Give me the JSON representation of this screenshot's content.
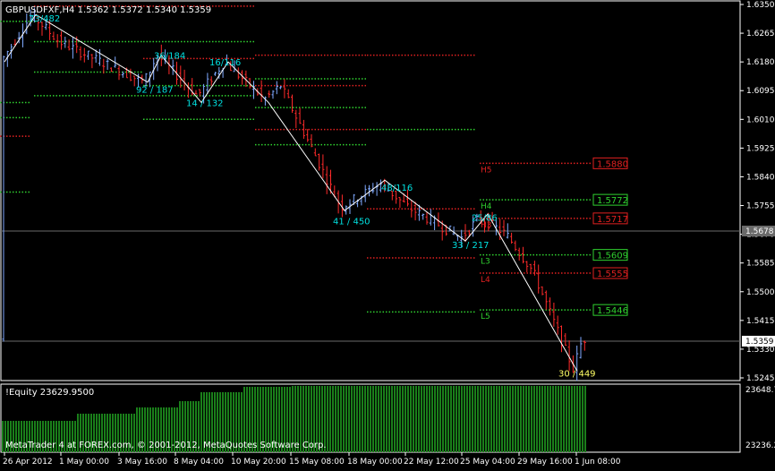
{
  "window": {
    "symbol_line": "GBPUSDFXF,H4  1.5362 1.5372 1.5340 1.5359",
    "indicator_label": "!Equity 23629.9500",
    "copyright": "MetaTrader 4 at FOREX.com, © 2001-2012, MetaQuotes Software Corp."
  },
  "colors": {
    "background": "#000000",
    "axis": "#ffffff",
    "bear_candle": "#ff2a2a",
    "bull_candle": "#7fa9ff",
    "support": "#2fd12f",
    "resistance": "#e02020",
    "zigzag": "#ffffff",
    "zigzag_label": "#00e0e0",
    "equity_bar": "#1a7f1a",
    "last_label": "#ffff66"
  },
  "chart_data": {
    "type": "candlestick",
    "price_axis": {
      "ticks": [
        "1.6350",
        "1.6265",
        "1.6180",
        "1.6095",
        "1.6010",
        "1.5925",
        "1.5840",
        "1.5755",
        "1.5670",
        "1.5585",
        "1.5500",
        "1.5415",
        "1.5330",
        "1.5245"
      ],
      "current_price": "1.5359",
      "current_price_marker": "1.5678"
    },
    "time_axis": {
      "ticks": [
        "26 Apr 2012",
        "1 May 00:00",
        "3 May 16:00",
        "8 May 04:00",
        "10 May 20:00",
        "15 May 08:00",
        "18 May 00:00",
        "22 May 12:00",
        "25 May 04:00",
        "29 May 16:00",
        "1 Jun 08:00"
      ]
    },
    "pivot_levels": [
      {
        "name": "H5",
        "value": "1.5880",
        "color": "#e02020"
      },
      {
        "name": "H4",
        "value": "1.5772",
        "color": "#2fd12f"
      },
      {
        "name": "H3",
        "value": "1.5717",
        "color": "#e02020"
      },
      {
        "name": "L3",
        "value": "1.5609",
        "color": "#2fd12f"
      },
      {
        "name": "L4",
        "value": "1.5555",
        "color": "#e02020"
      },
      {
        "name": "L5",
        "value": "1.5446",
        "color": "#2fd12f"
      }
    ],
    "zigzag_labels": [
      {
        "text": "73/482",
        "value": 1.631
      },
      {
        "text": "92 / 187",
        "value": 1.61
      },
      {
        "text": "36/184",
        "value": 1.62
      },
      {
        "text": "14 / 132",
        "value": 1.606
      },
      {
        "text": "16/116",
        "value": 1.618
      },
      {
        "text": "41 / 450",
        "value": 1.571
      },
      {
        "text": "48/116",
        "value": 1.581
      },
      {
        "text": "25/86",
        "value": 1.572
      },
      {
        "text": "33 / 217",
        "value": 1.564
      },
      {
        "text": "30 / 449",
        "value": 1.526
      }
    ],
    "equity_axis": {
      "ticks": [
        "23648.7",
        "23236.2"
      ]
    }
  }
}
